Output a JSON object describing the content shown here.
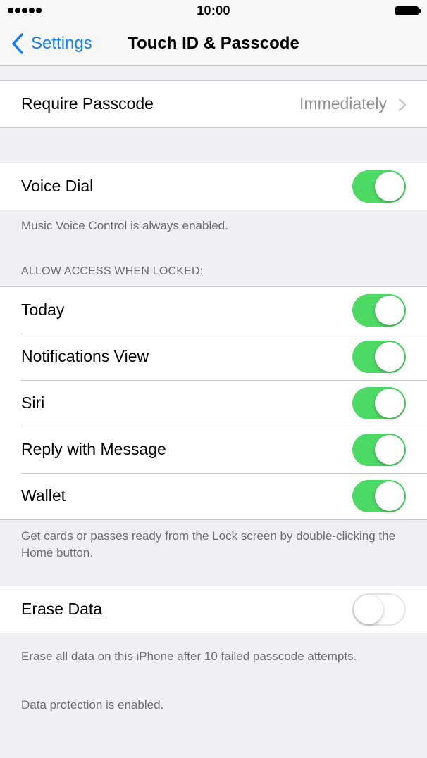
{
  "status_bar": {
    "time": "10:00"
  },
  "nav": {
    "back_label": "Settings",
    "title": "Touch ID & Passcode"
  },
  "require_passcode": {
    "label": "Require Passcode",
    "value": "Immediately"
  },
  "voice_dial": {
    "label": "Voice Dial",
    "enabled": true,
    "footer": "Music Voice Control is always enabled."
  },
  "locked_access": {
    "header": "ALLOW ACCESS WHEN LOCKED:",
    "items": [
      {
        "label": "Today",
        "enabled": true
      },
      {
        "label": "Notifications View",
        "enabled": true
      },
      {
        "label": "Siri",
        "enabled": true
      },
      {
        "label": "Reply with Message",
        "enabled": true
      },
      {
        "label": "Wallet",
        "enabled": true
      }
    ],
    "footer": "Get cards or passes ready from the Lock screen by double-clicking the Home button."
  },
  "erase_data": {
    "label": "Erase Data",
    "enabled": false,
    "footer": "Erase all data on this iPhone after 10 failed passcode attempts.",
    "footer2": "Data protection is enabled."
  },
  "colors": {
    "accent": "#147efb",
    "toggle_on": "#4cd964",
    "background": "#efeff4"
  }
}
